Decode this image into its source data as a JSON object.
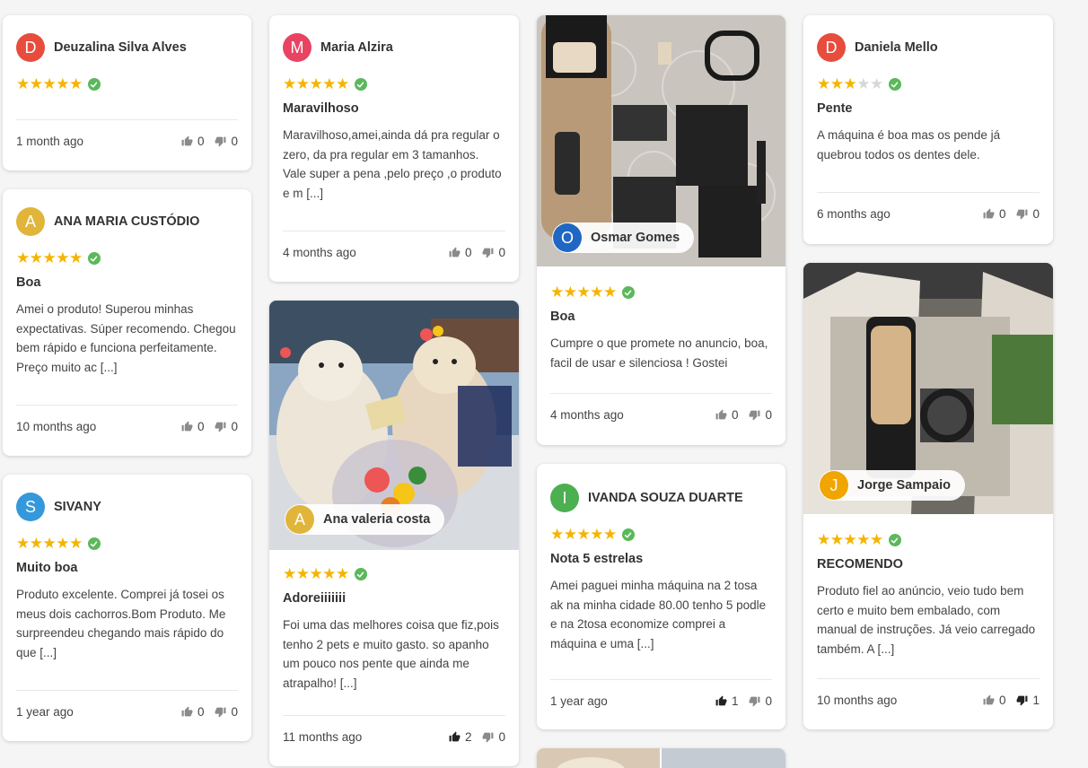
{
  "colors": {
    "star": "#f5b400",
    "verified": "#5cb85c"
  },
  "reviews": [
    {
      "author": "Deuzalina Silva Alves",
      "initial": "D",
      "avatar_color": "#e74c3c",
      "stars": 5,
      "title": "",
      "text": "",
      "date": "1 month ago",
      "likes": "0",
      "dislikes": "0"
    },
    {
      "author": "ANA MARIA CUSTÓDIO",
      "initial": "A",
      "avatar_color": "#e0b53a",
      "stars": 5,
      "title": "Boa",
      "text": "Amei o produto! Superou minhas expectativas. Súper recomendo. Chegou bem rápido e funciona perfeitamente. Preço muito ac [...]",
      "date": "10 months ago",
      "likes": "0",
      "dislikes": "0"
    },
    {
      "author": "SIVANY",
      "initial": "S",
      "avatar_color": "#3498db",
      "stars": 5,
      "title": "Muito boa",
      "text": "Produto excelente. Comprei já tosei os meus dois cachorros.Bom Produto. Me surpreendeu chegando mais rápido do que [...]",
      "date": "1 year ago",
      "likes": "0",
      "dislikes": "0"
    },
    {
      "author": "Maria Alzira",
      "initial": "M",
      "avatar_color": "#e84363",
      "stars": 5,
      "title": "Maravilhoso",
      "text": "Maravilhoso,amei,ainda dá pra regular o zero, da pra regular em 3 tamanhos. Vale super a pena ,pelo preço ,o produto e m [...]",
      "date": "4 months ago",
      "likes": "0",
      "dislikes": "0"
    },
    {
      "author": "Ana valeria costa",
      "initial": "A",
      "avatar_color": "#e0b53a",
      "stars": 5,
      "title": "Adoreiiiiiii",
      "text": "Foi uma das melhores coisa que fiz,pois tenho 2 pets e muito gasto. so apanho um pouco nos pente que ainda me atrapalho! [...]",
      "date": "11 months ago",
      "likes": "2",
      "dislikes": "0"
    },
    {
      "author": "Osmar Gomes",
      "initial": "O",
      "avatar_color": "#2067c4",
      "stars": 5,
      "title": "Boa",
      "text": "Cumpre o que promete no anuncio, boa, facil de usar e silenciosa ! Gostei",
      "date": "4 months ago",
      "likes": "0",
      "dislikes": "0"
    },
    {
      "author": "IVANDA SOUZA DUARTE",
      "initial": "I",
      "avatar_color": "#4caf50",
      "stars": 5,
      "title": "Nota 5 estrelas",
      "text": "Amei paguei minha máquina na 2 tosa ak na minha cidade 80.00 tenho 5 podle e na 2tosa economize comprei a máquina e uma [...]",
      "date": "1 year ago",
      "likes": "1",
      "dislikes": "0"
    },
    {
      "author": "Daniela Mello",
      "initial": "D",
      "avatar_color": "#e74c3c",
      "stars": 3,
      "title": "Pente",
      "text": "A máquina é boa mas os pende já quebrou todos os dentes dele.",
      "date": "6 months ago",
      "likes": "0",
      "dislikes": "0"
    },
    {
      "author": "Jorge Sampaio",
      "initial": "J",
      "avatar_color": "#f0a500",
      "stars": 5,
      "title": "RECOMENDO",
      "text": "Produto fiel ao anúncio, veio tudo bem certo e muito bem embalado, com manual de instruções. Já veio carregado também. A [...]",
      "date": "10 months ago",
      "likes": "0",
      "dislikes": "1"
    }
  ]
}
